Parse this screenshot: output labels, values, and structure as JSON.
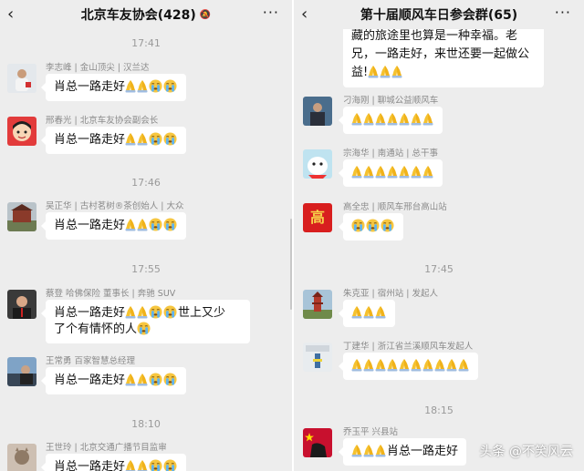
{
  "left": {
    "title": "北京车友协会(428)",
    "back_glyph": "‹",
    "more_glyph": "···",
    "mute_glyph": "🔕",
    "times": [
      "17:41",
      "17:46",
      "17:55",
      "18:10"
    ],
    "messages": [
      {
        "sender": "李志峰 | 金山顶尖 | 汉兰达",
        "text": "肖总一路走好"
      },
      {
        "sender": "邢春光 | 北京车友协会副会长",
        "text": "肖总一路走好"
      },
      {
        "sender": "吴正华 | 古村茗树®茶创始人 | 大众",
        "text": "肖总一路走好"
      },
      {
        "sender": "蔡登 哈佛保险 董事长 | 奔驰 SUV",
        "text": "肖总一路走好",
        "tail": "世上又少",
        "line2": "了个有情怀的人"
      },
      {
        "sender": "王常勇 百家智慧总经理",
        "text": "肖总一路走好"
      },
      {
        "sender": "王世玲 | 北京交通广播节目监审",
        "text": "肖总一路走好"
      }
    ]
  },
  "right": {
    "title": "第十届顺风车日参会群(65)",
    "back_glyph": "‹",
    "more_glyph": "···",
    "times": [
      "17:45",
      "18:15"
    ],
    "top_bubble": {
      "line1": "藏的旅途里也算是一种幸福。老",
      "line2": "兄，一路走好，来世还要一起做公",
      "line3": "益!"
    },
    "messages": [
      {
        "sender": "刁海刚 | 聊城公益顺风车"
      },
      {
        "sender": "宗海华 | 南通站 | 总干事"
      },
      {
        "sender": "高全忠 | 顺风车邢台高山站"
      },
      {
        "sender": "朱克亚 | 宿州站 | 发起人"
      },
      {
        "sender": "丁建华 | 浙江省兰溪顺风车发起人"
      },
      {
        "sender": "乔玉平 兴县站",
        "text": "肖总一路走好"
      }
    ],
    "avatar_text": "高"
  },
  "watermark": "头条 @不笑风云",
  "colors": {
    "background": "#ededed",
    "bubble": "#ffffff",
    "meta_text": "#8a8a8a"
  }
}
